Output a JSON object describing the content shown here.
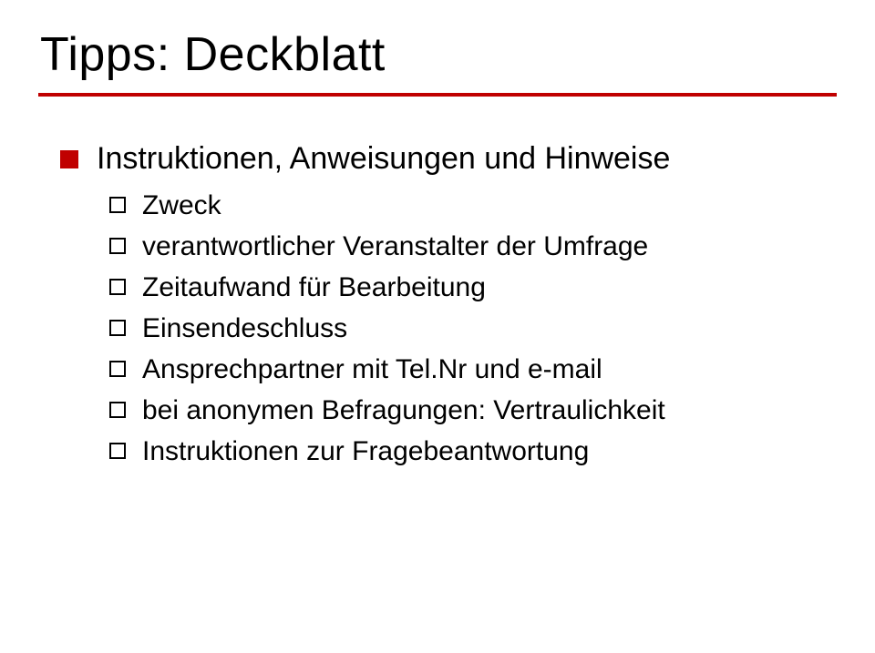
{
  "title": "Tipps: Deckblatt",
  "heading": "Instruktionen, Anweisungen und Hinweise",
  "items": [
    "Zweck",
    "verantwortlicher Veranstalter der Umfrage",
    "Zeitaufwand für Bearbeitung",
    "Einsendeschluss",
    "Ansprechpartner mit Tel.Nr und e-mail",
    "bei anonymen Befragungen: Vertraulichkeit",
    "Instruktionen zur Fragebeantwortung"
  ]
}
